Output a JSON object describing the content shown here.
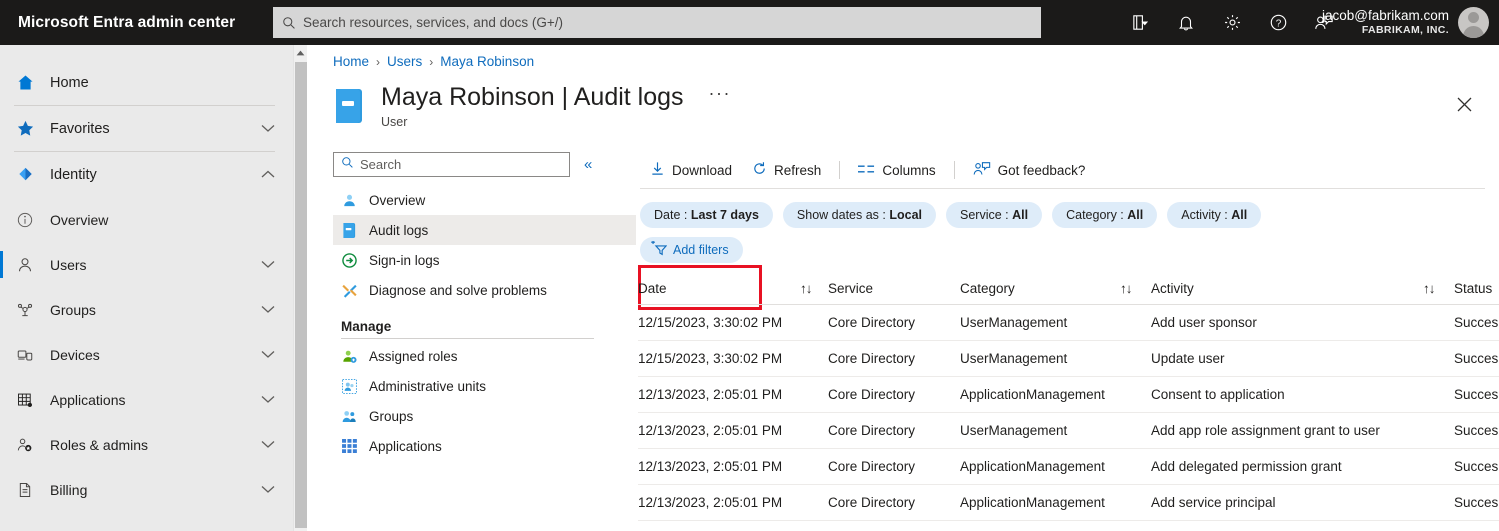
{
  "header": {
    "brand": "Microsoft Entra admin center",
    "search": {
      "placeholder": "Search resources, services, and docs (G+/)",
      "value": "",
      "icon": "search-icon"
    },
    "icons": [
      "feedback-list-icon",
      "notification-bell-icon",
      "gear-icon",
      "help-question-icon",
      "user-feedback-icon"
    ],
    "account": {
      "email": "jacob@fabrikam.com",
      "org": "FABRIKAM, INC."
    }
  },
  "sidebar": {
    "items": [
      {
        "label": "Home",
        "icon": "home-icon",
        "chevron": "",
        "selected": false
      },
      {
        "label": "Favorites",
        "icon": "star-icon",
        "chevron": "∨",
        "selected": false
      },
      {
        "label": "Identity",
        "icon": "identity-diamond-icon",
        "chevron": "∧",
        "selected": false
      },
      {
        "label": "Overview",
        "icon": "info-circle-icon",
        "chevron": "",
        "selected": false
      },
      {
        "label": "Users",
        "icon": "user-icon",
        "chevron": "∨",
        "selected": true
      },
      {
        "label": "Groups",
        "icon": "groups-icon",
        "chevron": "∨",
        "selected": false
      },
      {
        "label": "Devices",
        "icon": "devices-icon",
        "chevron": "∨",
        "selected": false
      },
      {
        "label": "Applications",
        "icon": "applications-grid-icon",
        "chevron": "∨",
        "selected": false
      },
      {
        "label": "Roles & admins",
        "icon": "roles-admins-icon",
        "chevron": "∨",
        "selected": false
      },
      {
        "label": "Billing",
        "icon": "billing-document-icon",
        "chevron": "∨",
        "selected": false
      }
    ]
  },
  "breadcrumb": {
    "items": [
      "Home",
      "Users",
      "Maya Robinson"
    ],
    "separator": "›"
  },
  "page": {
    "title_main": "Maya Robinson",
    "title_divider": "|",
    "title_section": "Audit logs",
    "ellipsis": "···",
    "subtitle": "User",
    "icon": "user-book-icon",
    "close_label": "×"
  },
  "innernav": {
    "search": {
      "placeholder": "Search",
      "value": "",
      "icon": "search-icon"
    },
    "collapse": "«",
    "items": [
      {
        "label": "Overview",
        "icon": "overview-user-icon",
        "active": false
      },
      {
        "label": "Audit logs",
        "icon": "audit-logs-book-icon",
        "active": true
      },
      {
        "label": "Sign-in logs",
        "icon": "signin-arrow-icon",
        "active": false
      },
      {
        "label": "Diagnose and solve problems",
        "icon": "diagnose-wrench-icon",
        "active": false
      }
    ],
    "manage_title": "Manage",
    "manage_items": [
      {
        "label": "Assigned roles",
        "icon": "assigned-roles-icon"
      },
      {
        "label": "Administrative units",
        "icon": "administrative-units-icon"
      },
      {
        "label": "Groups",
        "icon": "groups-people-icon"
      },
      {
        "label": "Applications",
        "icon": "applications-grid-icon"
      }
    ]
  },
  "toolbar": {
    "commands": [
      {
        "label": "Download",
        "icon": "download-icon"
      },
      {
        "label": "Refresh",
        "icon": "refresh-icon"
      },
      {
        "label": "Columns",
        "icon": "columns-icon"
      },
      {
        "label": "Got feedback?",
        "icon": "feedback-person-icon"
      }
    ]
  },
  "filters": {
    "pills": [
      {
        "name": "Date",
        "value": "Last 7 days"
      },
      {
        "name": "Show dates as",
        "value": "Local"
      },
      {
        "name": "Service",
        "value": "All"
      },
      {
        "name": "Category",
        "value": "All"
      },
      {
        "name": "Activity",
        "value": "All"
      }
    ],
    "add_filters": {
      "label": "Add filters",
      "icon": "add-filter-icon"
    }
  },
  "table": {
    "columns": [
      {
        "key": "date",
        "label": "Date",
        "sortable": true
      },
      {
        "key": "service",
        "label": "Service",
        "sortable": false
      },
      {
        "key": "category",
        "label": "Category",
        "sortable": true
      },
      {
        "key": "activity",
        "label": "Activity",
        "sortable": true
      },
      {
        "key": "status",
        "label": "Status",
        "sortable": false
      }
    ],
    "sort_glyph": "↑↓",
    "rows": [
      {
        "date": "12/15/2023, 3:30:02 PM",
        "service": "Core Directory",
        "category": "UserManagement",
        "activity": "Add user sponsor",
        "status": "Succes"
      },
      {
        "date": "12/15/2023, 3:30:02 PM",
        "service": "Core Directory",
        "category": "UserManagement",
        "activity": "Update user",
        "status": "Succes"
      },
      {
        "date": "12/13/2023, 2:05:01 PM",
        "service": "Core Directory",
        "category": "ApplicationManagement",
        "activity": "Consent to application",
        "status": "Succes"
      },
      {
        "date": "12/13/2023, 2:05:01 PM",
        "service": "Core Directory",
        "category": "UserManagement",
        "activity": "Add app role assignment grant to user",
        "status": "Succes"
      },
      {
        "date": "12/13/2023, 2:05:01 PM",
        "service": "Core Directory",
        "category": "ApplicationManagement",
        "activity": "Add delegated permission grant",
        "status": "Succes"
      },
      {
        "date": "12/13/2023, 2:05:01 PM",
        "service": "Core Directory",
        "category": "ApplicationManagement",
        "activity": "Add service principal",
        "status": "Succes"
      }
    ]
  },
  "colors": {
    "header_bg": "#1b1a19",
    "accent_blue": "#0078d4",
    "link_blue": "#0f6cbd",
    "pill_bg": "#deecf9",
    "highlight_red": "#e81123",
    "sidebar_bg": "#eaeaea"
  }
}
